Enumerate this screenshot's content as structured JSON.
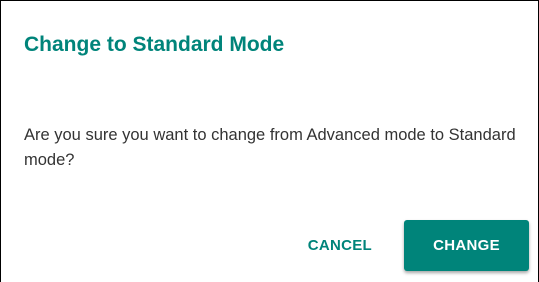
{
  "dialog": {
    "title": "Change to Standard Mode",
    "message": "Are you sure you want to change from Advanced mode to Standard mode?",
    "cancel_label": "CANCEL",
    "change_label": "CHANGE"
  },
  "colors": {
    "accent": "#00847a",
    "text": "#333333",
    "background": "#ffffff"
  }
}
